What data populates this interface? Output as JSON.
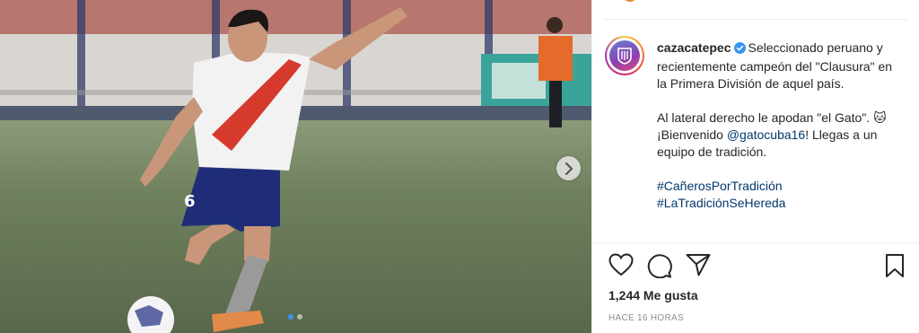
{
  "post": {
    "username": "cazacatepec",
    "caption_lines": {
      "intro": "Seleccionado peruano y recientemente campeón del \"Clausura\" en la Primera División de aquel país.",
      "p2_before": "Al lateral derecho le apodan \"el Gato\". ",
      "p2_emoji": "🐱",
      "p2_welcome": " ¡Bienvenido ",
      "p2_mention": "@gatocuba16",
      "p2_after": "! Llegas a un equipo de tradición.",
      "hashtag_1": "#CañerosPorTradición",
      "hashtag_2": "#LaTradiciónSeHereda"
    },
    "likes": "1,244 Me gusta",
    "time_ago": "HACE 16 HORAS",
    "carousel": {
      "current": 1,
      "total": 2
    },
    "jersey_number": "6"
  },
  "icons": {
    "like": "heart-icon",
    "comment": "comment-icon",
    "share": "share-icon",
    "save": "bookmark-icon",
    "next": "chevron-right-icon",
    "verified": "verified-badge-icon"
  },
  "colors": {
    "text": "#262626",
    "link": "#00376b",
    "muted": "#8e8e8e",
    "verified": "#3897f0",
    "divider": "#efefef"
  }
}
